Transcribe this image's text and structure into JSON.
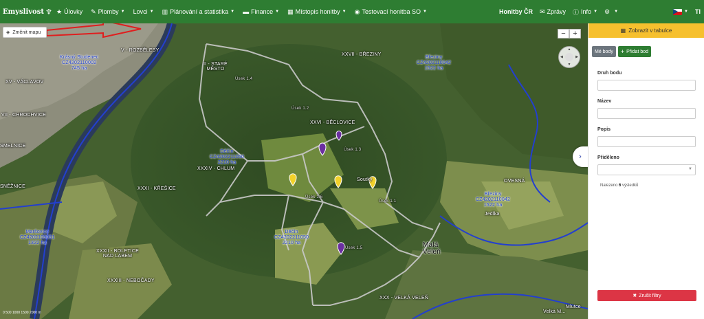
{
  "app": {
    "brand": "Emyslivost"
  },
  "nav": {
    "items": [
      {
        "icon": "star-icon",
        "glyph": "★",
        "label": "Úlovky",
        "dropdown": false
      },
      {
        "icon": "tag-icon",
        "glyph": "✎",
        "label": "Plomby",
        "dropdown": true
      },
      {
        "icon": "",
        "glyph": "",
        "label": "Lovci",
        "dropdown": true
      },
      {
        "icon": "chart-icon",
        "glyph": "▥",
        "label": "Plánování a statistika",
        "dropdown": true
      },
      {
        "icon": "money-icon",
        "glyph": "▬",
        "label": "Finance",
        "dropdown": true
      },
      {
        "icon": "map-icon",
        "glyph": "▦",
        "label": "Místopis honitby",
        "dropdown": true
      },
      {
        "icon": "globe-icon",
        "glyph": "◉",
        "label": "Testovací honitba SO",
        "dropdown": true
      }
    ],
    "right": {
      "honitby": "Honitby ČR",
      "zpravy": "Zprávy",
      "info": "Info",
      "settings_caret": "▾",
      "text_size": "TI"
    }
  },
  "map": {
    "change_map_label": "Změnit mapu",
    "zoom_out": "−",
    "zoom_in": "+",
    "expand_glyph": "›",
    "scale_text": "0 500 1000 1500 2000 m",
    "labels": {
      "rozbelesy": "V - ROZBĚLESY",
      "stare_mesto": "II - STARÉ\nMĚSTO",
      "breziny": "XXVII - BŘEZINY",
      "krasny_studenec": "Krásný Studenec\nCZ4202110002\n745 ha",
      "brezin1": "Březiny\nCZ4202110042\n1522 ha",
      "vaclavov": "XV - VÁCLAVOV",
      "chrochvice": "VII - CHROCHVICE",
      "smelnice": "SMELNICE",
      "beclovice": "XXVI - BĚCLOVICE",
      "decin1": "Děčín\nCZ4202211050\n2210 ha",
      "chlum": "XXXIV - CHLUM",
      "kresice": "XXXI - KŘEŠICE",
      "sneznice": "SNĚŽNICE",
      "ovesna": "OVESNÁ",
      "brezin2": "Březiny\nCZ4202110042\n1522 ha",
      "jedlka": "Jedlka",
      "marsovice": "Maršovice\nCZ4202109051\n1322 ha",
      "decin2": "Děčín\nCZ4202211050\n2210 ha",
      "boletice": "XXXII - BOLETICE\nNAD LABEM",
      "nebocady": "XXXIII - NEBOČADY",
      "mala_velen": "Malá\nVeleň",
      "velka_velen": "XXX - VELKÁ VELEŇ",
      "soutky": "Soutky",
      "usek14": "Úsek 1.4",
      "usek12": "Úsek 1.2",
      "usek13": "Úsek 1.3",
      "usek16": "Úsek 1.6",
      "usek11": "Úsek 1.1",
      "usek15": "Úsek 1.5",
      "folklore": "Velká M...",
      "mlutce": "Mlutce"
    }
  },
  "panel": {
    "show_table": "Zobrazit v tabulce",
    "my_points": "Mé body",
    "add_point": "Přidat bod",
    "fields": {
      "druh_bodu": "Druh bodu",
      "nazev": "Název",
      "popis": "Popis",
      "prideleno": "Přiděleno"
    },
    "found_prefix": "Nalezeno",
    "found_count": "6",
    "found_suffix": "výsledků",
    "clear_filters": "Zrušit filtry"
  }
}
